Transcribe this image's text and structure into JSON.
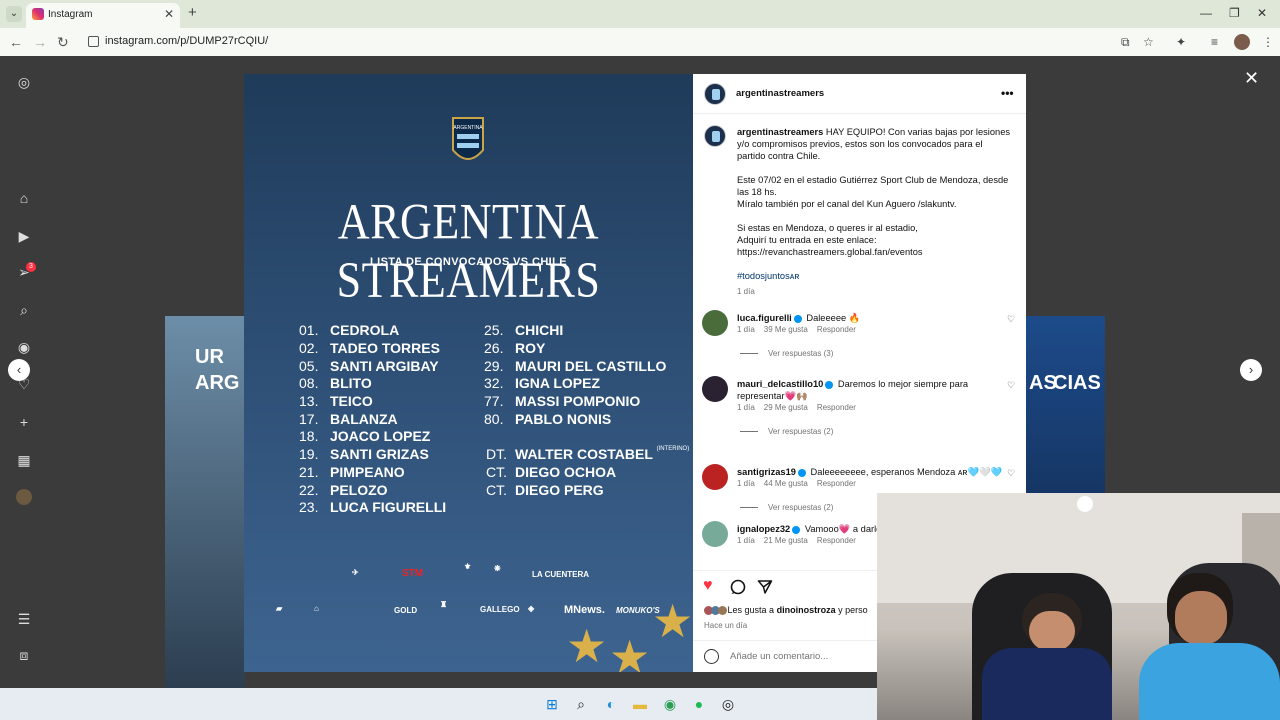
{
  "browser": {
    "tab_title": "Instagram",
    "url": "instagram.com/p/DUMP27rCQIU/"
  },
  "post": {
    "poster": {
      "title": "ARGENTINA STREAMERS",
      "subtitle": "LISTA DE CONVOCADOS VS CHILE",
      "left_list": [
        {
          "num": "01.",
          "name": "CEDROLA"
        },
        {
          "num": "02.",
          "name": "TADEO TORRES"
        },
        {
          "num": "05.",
          "name": "SANTI ARGIBAY"
        },
        {
          "num": "08.",
          "name": "BLITO"
        },
        {
          "num": "13.",
          "name": "TEICO"
        },
        {
          "num": "17.",
          "name": "BALANZA"
        },
        {
          "num": "18.",
          "name": "JOACO LOPEZ"
        },
        {
          "num": "19.",
          "name": "SANTI GRIZAS"
        },
        {
          "num": "21.",
          "name": "PIMPEANO"
        },
        {
          "num": "22.",
          "name": "PELOZO"
        },
        {
          "num": "23.",
          "name": "LUCA FIGURELLI"
        }
      ],
      "right_list": [
        {
          "num": "25.",
          "name": "CHICHI"
        },
        {
          "num": "26.",
          "name": "ROY"
        },
        {
          "num": "29.",
          "name": "MAURI DEL CASTILLO"
        },
        {
          "num": "32.",
          "name": "IGNA LOPEZ"
        },
        {
          "num": "77.",
          "name": "MASSI POMPONIO"
        },
        {
          "num": "80.",
          "name": "PABLO NONIS"
        }
      ],
      "staff": [
        {
          "role": "DT.",
          "name": "WALTER COSTABEL",
          "note": "(INTERINO)"
        },
        {
          "role": "CT.",
          "name": "DIEGO OCHOA",
          "note": ""
        },
        {
          "role": "CT.",
          "name": "DIEGO PERG",
          "note": ""
        }
      ],
      "sponsors": {
        "stm": "STM",
        "la_cuentera": "LA CUENTERA",
        "gold": "GOLD",
        "gallego": "GALLEGO",
        "mnews": "MNews.",
        "monuko": "MONUKO'S"
      }
    },
    "account": "argentinastreamers",
    "caption": {
      "p1": "HAY EQUIPO! Con varias bajas por lesiones y/o compromisos previos, estos son los convocados para el partido contra Chile.",
      "p2a": "Este 07/02 en el estadio Gutiérrez Sport Club de Mendoza, desde las 18 hs.",
      "p2b": "Míralo también por el canal del Kun Aguero /slakuntv.",
      "p3a": "Si estas en Mendoza, o queres ir al estadio,",
      "p3b": "Adquirí tu entrada en este enlace:",
      "p3c": "https://revanchastreamers.global.fan/eventos",
      "hashtag": "#todosjuntosᴀʀ",
      "time": "1 día"
    },
    "comments": [
      {
        "user": "luca.figurelli",
        "text": "Daleeeee 🔥",
        "time": "1 día",
        "likes": "39 Me gusta",
        "reply": "Responder",
        "replies": "Ver respuestas (3)"
      },
      {
        "user": "mauri_delcastillo10",
        "text": "Daremos lo mejor siempre para representar💗🙌🏽",
        "time": "1 día",
        "likes": "29 Me gusta",
        "reply": "Responder",
        "replies": "Ver respuestas (2)"
      },
      {
        "user": "santigrizas19",
        "text": "Daleeeeeeee, esperanos Mendoza ᴀʀ🩵🤍🩵",
        "time": "1 día",
        "likes": "44 Me gusta",
        "reply": "Responder",
        "replies": "Ver respuestas (2)"
      },
      {
        "user": "ignalopez32",
        "text": "Vamooo💗 a darlo",
        "time": "1 día",
        "likes": "21 Me gusta",
        "reply": "Responder",
        "replies": ""
      }
    ],
    "likes_prefix": "Les gusta a",
    "likes_user": "dinoinostroza",
    "likes_suffix": "y perso",
    "ago": "Hace un día",
    "add_comment_placeholder": "Añade un comentario...",
    "notification_count": "3"
  },
  "background": {
    "left_card_text": "UR\nARG",
    "right_card_text": "AS\nCIAS"
  },
  "colors": {
    "ig_red": "#ff3040",
    "link_blue": "#00376b",
    "verified": "#0095f6"
  }
}
